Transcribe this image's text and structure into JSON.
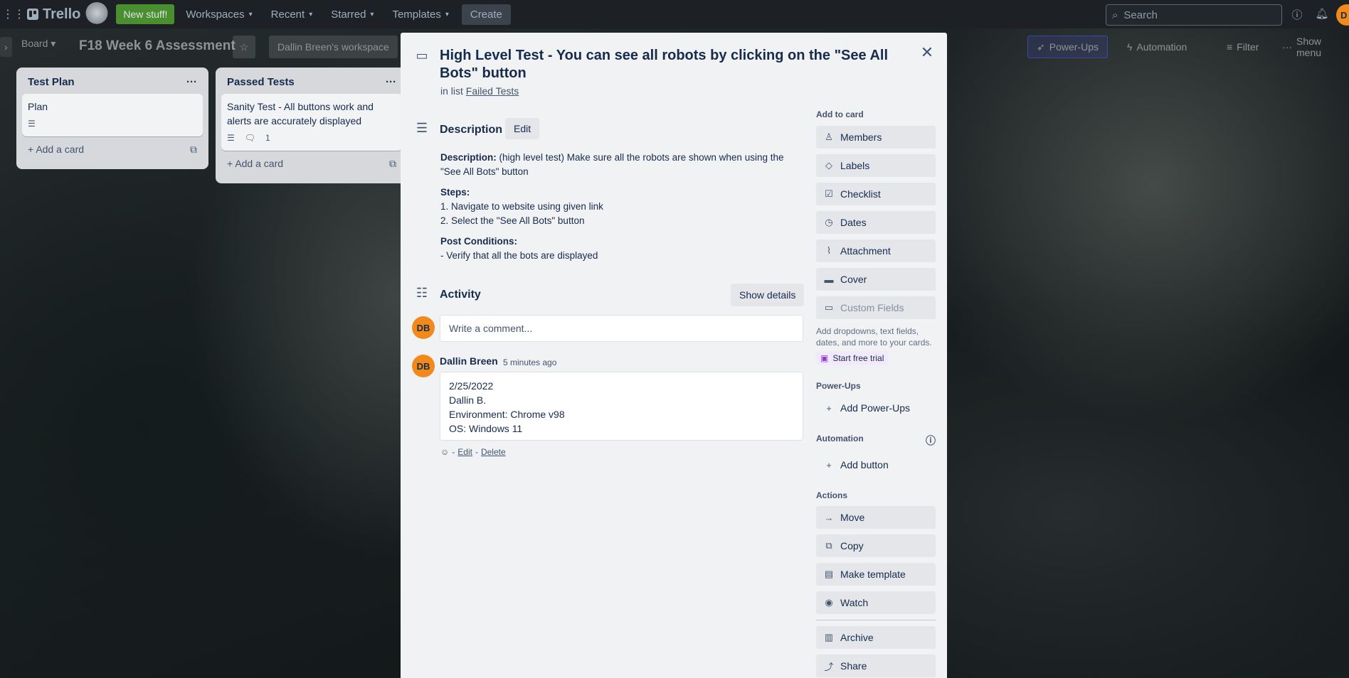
{
  "topnav": {
    "logo": "Trello",
    "new_stuff": "New stuff!",
    "menu": [
      "Workspaces",
      "Recent",
      "Starred",
      "Templates"
    ],
    "create": "Create",
    "search_placeholder": "Search",
    "avatar": "D"
  },
  "board": {
    "view": "Board",
    "title": "F18 Week 6 Assessment",
    "workspace": "Dallin Breen's workspace",
    "powerups": "Power-Ups",
    "automation": "Automation",
    "filter": "Filter",
    "show_menu": "Show menu"
  },
  "lists": [
    {
      "title": "Test Plan",
      "cards": [
        {
          "text": "Plan",
          "comments": ""
        }
      ],
      "add": "Add a card"
    },
    {
      "title": "Passed Tests",
      "cards": [
        {
          "text": "Sanity Test - All buttons work and alerts are accurately displayed",
          "comments": "1"
        }
      ],
      "add": "Add a card"
    }
  ],
  "card": {
    "title": "High Level Test - You can see all robots by clicking on the \"See All Bots\" button",
    "in_list_prefix": "in list",
    "list_name": "Failed Tests",
    "description_heading": "Description",
    "edit": "Edit",
    "desc_label": "Description:",
    "desc_text": " (high level test) Make sure all the robots are shown when using the \"See All Bots\" button",
    "steps_label": "Steps:",
    "step1": "1. Navigate to website using given link",
    "step2": "2. Select the \"See All Bots\" button",
    "post_label": "Post Conditions:",
    "post1": "- Verify that all the bots are displayed",
    "activity_heading": "Activity",
    "show_details": "Show details",
    "avatar_initials": "DB",
    "comment_placeholder": "Write a comment...",
    "comment": {
      "author": "Dallin Breen",
      "time": "5 minutes ago",
      "lines": [
        "2/25/2022",
        "Dallin B.",
        "Environment: Chrome v98",
        "OS: Windows 11"
      ],
      "edit": "Edit",
      "delete": "Delete"
    }
  },
  "sidebar": {
    "add_to_card": "Add to card",
    "add_items": [
      "Members",
      "Labels",
      "Checklist",
      "Dates",
      "Attachment",
      "Cover",
      "Custom Fields"
    ],
    "custom_hint": "Add dropdowns, text fields, dates, and more to your cards.",
    "trial": "Start free trial",
    "powerups_label": "Power-Ups",
    "add_powerups": "Add Power-Ups",
    "automation_label": "Automation",
    "add_button": "Add button",
    "actions_label": "Actions",
    "actions": [
      "Move",
      "Copy",
      "Make template",
      "Watch",
      "Archive",
      "Share"
    ]
  },
  "colors": {
    "avatar": "#f28a1b",
    "new_stuff": "#4a8f2f",
    "trial_bg": "#f3e9fc"
  }
}
